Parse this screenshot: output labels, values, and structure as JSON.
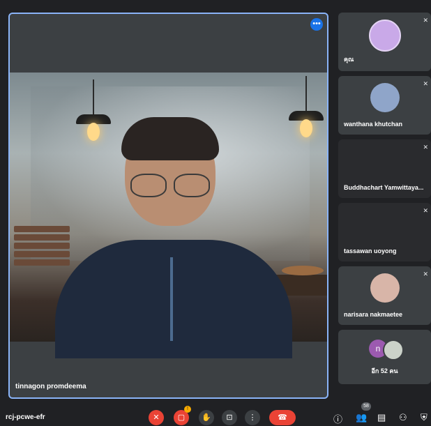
{
  "main": {
    "speaker_name": "tinnagon promdeema",
    "more_icon": "more-horizontal-icon"
  },
  "sidebar": {
    "tiles": [
      {
        "name": "คุณ",
        "mic": "mic-off-icon"
      },
      {
        "name": "wanthana khutchan",
        "mic": "mic-off-icon"
      },
      {
        "name": "Buddhachart Yamwittaya...",
        "mic": "mic-off-icon"
      },
      {
        "name": "tassawan uoyong",
        "mic": "mic-off-icon"
      },
      {
        "name": "narisara nakmaetee",
        "mic": "mic-off-icon"
      }
    ],
    "others": {
      "initial": "n",
      "label": "อีก 52 คน"
    }
  },
  "bottom_bar": {
    "meeting_code": "rcj-pcwe-efr",
    "camera_alert": "!",
    "participants_count": "58",
    "colors": {
      "end_call": "#ea4335",
      "accent": "#8ab4f8"
    }
  }
}
